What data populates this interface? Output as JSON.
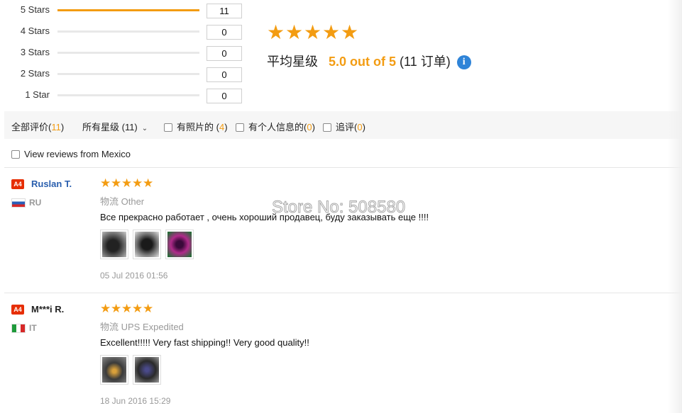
{
  "rating_summary": {
    "rows": [
      {
        "label": "5 Stars",
        "count": "11",
        "fill": 1.0
      },
      {
        "label": "4 Stars",
        "count": "0",
        "fill": 0.0
      },
      {
        "label": "3 Stars",
        "count": "0",
        "fill": 0.0
      },
      {
        "label": "2 Stars",
        "count": "0",
        "fill": 0.0
      },
      {
        "label": "1 Star",
        "count": "0",
        "fill": 0.0
      }
    ],
    "average_label": "平均星级",
    "average_value": "5.0 out of 5",
    "order_count": "(11 订单)",
    "star_rating": 5,
    "accent_color": "#f39c12"
  },
  "filters": {
    "all_label": "全部评价",
    "all_count": "11",
    "star_filter_label": "所有星级 (11)",
    "photos_label": "有照片的",
    "photos_count": "4",
    "personal_label": "有个人信息的",
    "personal_count": "0",
    "followup_label": "追评",
    "followup_count": "0",
    "country_label": "View reviews from Mexico"
  },
  "watermark": "Store No: 508580",
  "reviews": [
    {
      "badge": "A4",
      "name": "Ruslan T.",
      "name_color": "#2a5fae",
      "country": "RU",
      "flag_icon": "russia-flag-icon",
      "stars": 5,
      "shipping": "物流 Other",
      "text": "Все прекрасно работает , очень хороший продавец, буду заказывать еще !!!!",
      "photos": [
        "photo-thumb",
        "photo-thumb",
        "photo-thumb"
      ],
      "date": "05 Jul 2016 01:56"
    },
    {
      "badge": "A4",
      "name": "M***i R.",
      "name_color": "#222222",
      "country": "IT",
      "flag_icon": "italy-flag-icon",
      "stars": 5,
      "shipping": "物流 UPS Expedited",
      "text": "Excellent!!!!! Very fast shipping!! Very good quality!!",
      "photos": [
        "photo-thumb",
        "photo-thumb"
      ],
      "date": "18 Jun 2016 15:29"
    }
  ]
}
